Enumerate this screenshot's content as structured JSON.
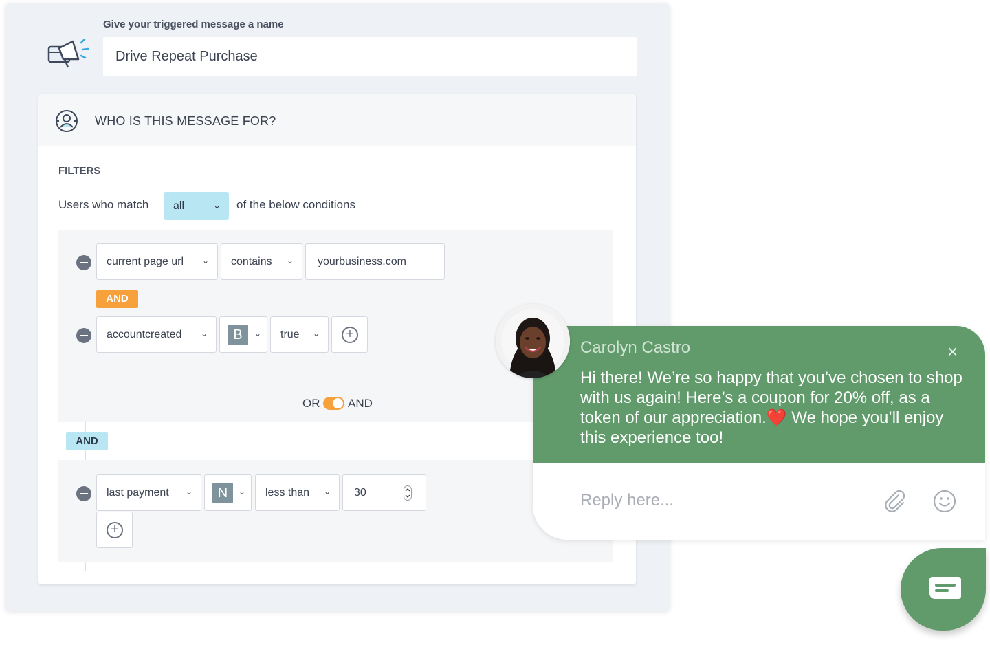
{
  "message_name": {
    "label": "Give your  triggered  message a name",
    "value": "Drive Repeat Purchase"
  },
  "audience": {
    "title": "WHO IS THIS MESSAGE FOR?",
    "filters_label": "FILTERS",
    "match_prefix": "Users who match",
    "match_value": "all",
    "match_suffix": "of the below conditions"
  },
  "group1": {
    "row1": {
      "attribute": "current page url",
      "operator": "contains",
      "value": "yourbusiness.com"
    },
    "connector": "AND",
    "row2": {
      "attribute": "accountcreated",
      "type_badge": "B",
      "value": "true"
    }
  },
  "group_toggle": {
    "left": "OR",
    "right": "AND"
  },
  "group_connector": "AND",
  "group2": {
    "row1": {
      "attribute": "last payment",
      "type_badge": "N",
      "operator": "less than",
      "value": "30"
    }
  },
  "chat": {
    "sender": "Carolyn Castro",
    "message": "Hi there! We’re so happy that you’ve chosen to shop with us again! Here’s a coupon for 20% off, as a token of our appreciation.❤️ We hope you’ll enjoy this experience too!",
    "reply_placeholder": "Reply here...",
    "close_icon": "×"
  },
  "colors": {
    "chat_green": "#619a6b",
    "accent_orange": "#f7a13c",
    "accent_blue": "#b9e6f3"
  }
}
